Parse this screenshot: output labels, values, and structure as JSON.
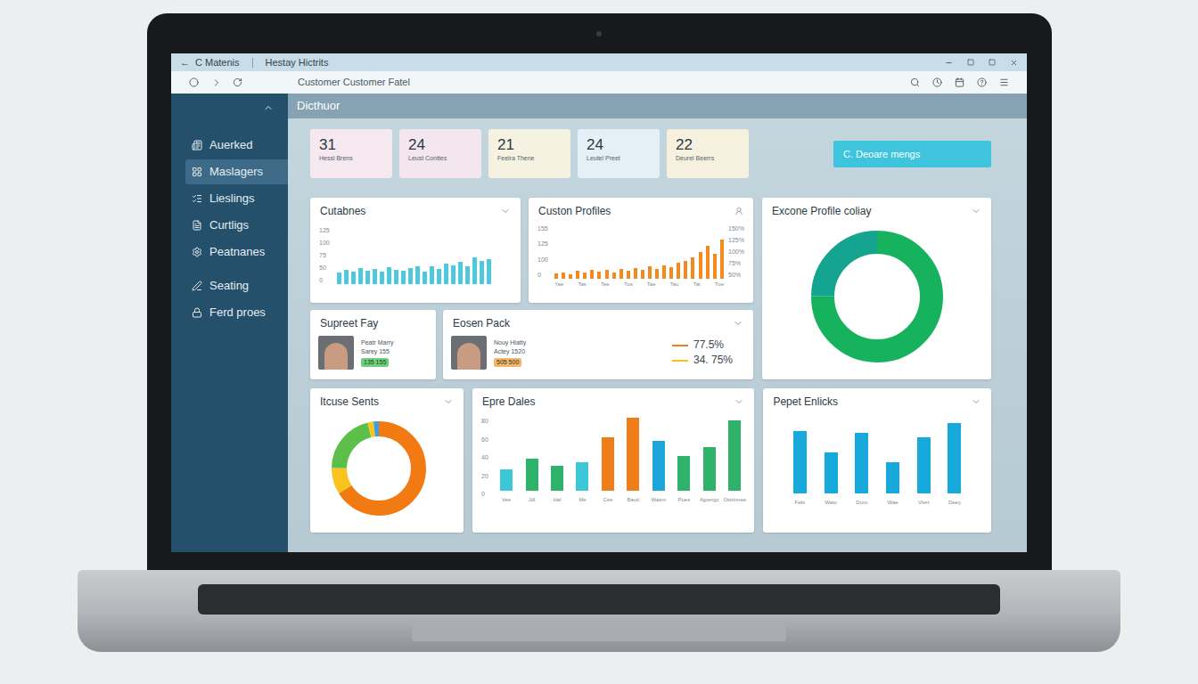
{
  "window": {
    "back": "←",
    "title": "C Matenis",
    "tab": "Hestay Hictrits",
    "address": "Customer Customer Fatel"
  },
  "sidebar": {
    "items": [
      {
        "label": "Auerked",
        "selected": false
      },
      {
        "label": "Maslagers",
        "selected": true
      },
      {
        "label": "Lieslings",
        "selected": false
      },
      {
        "label": "Curtligs",
        "selected": false
      },
      {
        "label": "Peatnanes",
        "selected": false
      },
      {
        "label": "Seating",
        "selected": false
      },
      {
        "label": "Ferd proes",
        "selected": false
      }
    ]
  },
  "header": {
    "title": "Dicthuor"
  },
  "stats": [
    {
      "value": "31",
      "label": "Hessl Brens",
      "color": "#f6e8ef"
    },
    {
      "value": "24",
      "label": "Leust Conttes",
      "color": "#f4e6ee"
    },
    {
      "value": "21",
      "label": "Feelra Thene",
      "color": "#f5f2e2"
    },
    {
      "value": "24",
      "label": "Leutel Preet",
      "color": "#e4f0f6"
    },
    {
      "value": "22",
      "label": "Deurel Beerrs",
      "color": "#f6f1df"
    }
  ],
  "action_button": {
    "label": "C. Deoare mengs"
  },
  "customers_chart": {
    "title": "Cutabnes",
    "ticks": [
      "125",
      "100",
      "75",
      "50",
      "0"
    ],
    "max": 150,
    "color": "#4ec8dc",
    "values": [
      30,
      38,
      32,
      42,
      36,
      40,
      34,
      44,
      38,
      36,
      42,
      46,
      34,
      46,
      40,
      54,
      50,
      58,
      46,
      70,
      62,
      66
    ]
  },
  "profiles_chart": {
    "title": "Custon Profiles",
    "ticks_left": [
      "155",
      "125",
      "100",
      "0"
    ],
    "ticks_right": [
      "150%",
      "125%",
      "100%",
      "75%",
      "50%"
    ],
    "max": 150,
    "color": "#f28a1c",
    "x_labels": [
      "Yae",
      "Tas",
      "Tee",
      "Tus",
      "Tae",
      "Tau",
      "Tat",
      "Tue"
    ],
    "values": [
      14,
      18,
      12,
      22,
      18,
      24,
      20,
      26,
      18,
      28,
      22,
      30,
      24,
      34,
      28,
      38,
      32,
      44,
      50,
      60,
      74,
      92,
      70,
      110
    ]
  },
  "profile_donut": {
    "title": "Excone Profile coliay",
    "segments": [
      {
        "value": 75,
        "color": "#16b25e"
      },
      {
        "value": 25,
        "color": "#14a48f"
      }
    ]
  },
  "supreet_card": {
    "title": "Supreet Fay",
    "name": "Peatr Marry",
    "meta": "Sarey 155",
    "badge": "135 155",
    "badge_color": "#6fcf7a"
  },
  "eosen_card": {
    "title": "Eosen Pack",
    "name": "Nouy Hlatty",
    "meta": "Actey 1520",
    "badge": "505 500",
    "badge_color": "#f5b56a",
    "legend": [
      {
        "value": "77.5%",
        "color": "#f07d18"
      },
      {
        "value": "34. 75%",
        "color": "#f5c21b"
      }
    ]
  },
  "sales_donut": {
    "title": "Itcuse Sents",
    "segments": [
      {
        "value": 66,
        "color": "#f27a12"
      },
      {
        "value": 9,
        "color": "#f7c31c"
      },
      {
        "value": 21,
        "color": "#5cbf4a"
      },
      {
        "value": 2,
        "color": "#f7c31c"
      },
      {
        "value": 2,
        "color": "#3d9fe0"
      }
    ]
  },
  "dales_chart": {
    "title": "Epre Dales",
    "ticks": [
      "80",
      "60",
      "40",
      "20",
      "0"
    ],
    "max": 90,
    "bars": [
      {
        "label": "Ves",
        "value": 24,
        "color": "#3cc6d8"
      },
      {
        "label": "Jdl",
        "value": 36,
        "color": "#2fb36a"
      },
      {
        "label": "Hal",
        "value": 28,
        "color": "#2fb36a"
      },
      {
        "label": "Me",
        "value": 32,
        "color": "#3cc6d8"
      },
      {
        "label": "Ces",
        "value": 60,
        "color": "#f07d18"
      },
      {
        "label": "Bauti",
        "value": 82,
        "color": "#f07d18"
      },
      {
        "label": "Wasm",
        "value": 56,
        "color": "#1ea6dc"
      },
      {
        "label": "Poes",
        "value": 39,
        "color": "#2fb36a"
      },
      {
        "label": "Ajperigc",
        "value": 49,
        "color": "#2fb36a"
      },
      {
        "label": "Osttinnee",
        "value": 79,
        "color": "#2fb36a"
      }
    ]
  },
  "enlicks_chart": {
    "title": "Pepet Enlicks",
    "max": 100,
    "color": "#18a9dc",
    "bars": [
      {
        "label": "Febi",
        "value": 80
      },
      {
        "label": "Waio",
        "value": 53
      },
      {
        "label": "Doro",
        "value": 78
      },
      {
        "label": "Wae",
        "value": 40
      },
      {
        "label": "Vlert",
        "value": 72
      },
      {
        "label": "Deey",
        "value": 90
      }
    ]
  }
}
